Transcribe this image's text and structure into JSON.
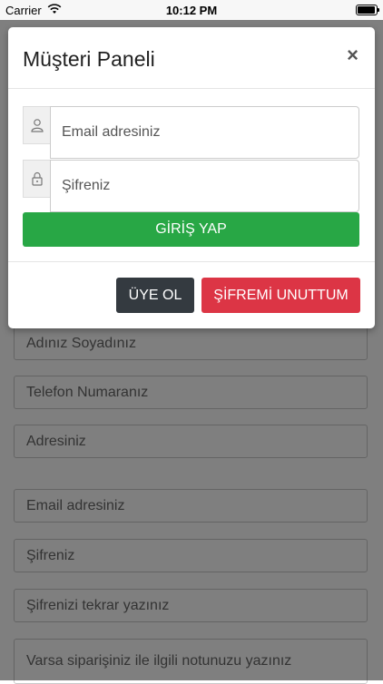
{
  "status_bar": {
    "carrier": "Carrier",
    "time": "10:12 PM"
  },
  "modal": {
    "title": "Müşteri Paneli",
    "close_label": "×",
    "email_placeholder": "Email adresiniz",
    "password_placeholder": "Şifreniz",
    "login_label": "GİRİŞ YAP",
    "register_label": "ÜYE OL",
    "forgot_label": "ŞİFREMİ UNUTTUM"
  },
  "background_form": {
    "fields": [
      "Adınız Soyadınız",
      "Telefon Numaranız",
      "Adresiniz",
      "Email adresiniz",
      "Şifreniz",
      "Şifrenizi tekrar yazınız",
      "Varsa siparişiniz ile ilgili notunuzu yazınız"
    ]
  },
  "colors": {
    "success": "#28a745",
    "danger": "#dc3545",
    "dark": "#343a40"
  }
}
